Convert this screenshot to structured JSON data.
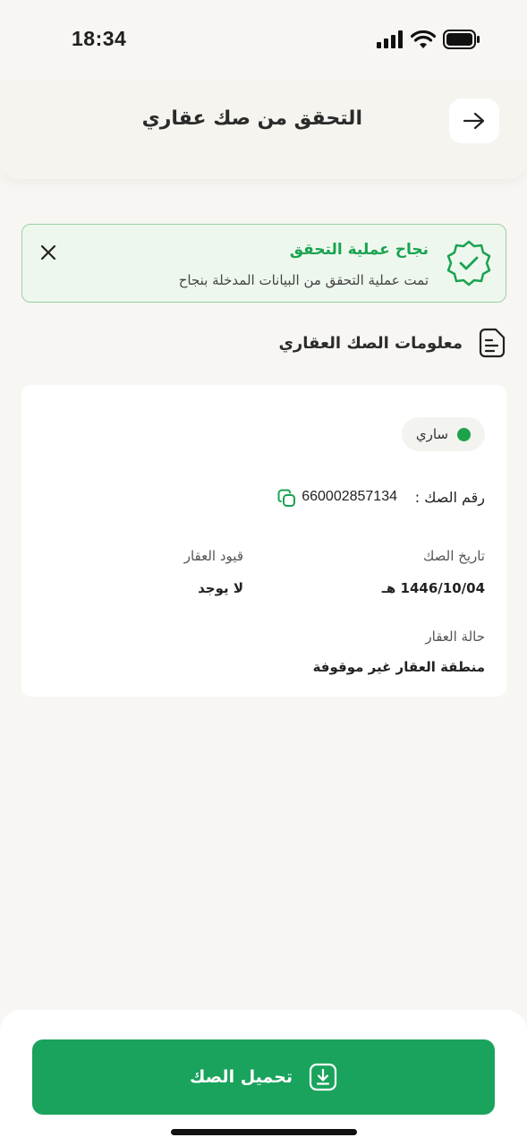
{
  "status_bar": {
    "time": "18:34"
  },
  "header": {
    "title": "التحقق من صك عقاري"
  },
  "alert": {
    "title": "نجاح عملية التحقق",
    "message": "تمت عملية التحقق من البيانات المدخلة بنجاح",
    "accent": "#1aa350"
  },
  "section": {
    "title": "معلومات الصك العقاري"
  },
  "deed": {
    "status": "ساري",
    "number_label": "رقم الصك :",
    "number": "660002857134",
    "date_label": "تاريخ الصك",
    "date_value": "1446/10/04 هـ",
    "restrictions_label": "قيود العقار",
    "restrictions_value": "لا يوجد",
    "property_status_label": "حالة العقار",
    "property_status_value": "منطقة العقار غير موقوفة"
  },
  "actions": {
    "download_label": "تحميل الصك"
  },
  "colors": {
    "primary_green": "#1aa35c",
    "status_green": "#1aa34a"
  }
}
